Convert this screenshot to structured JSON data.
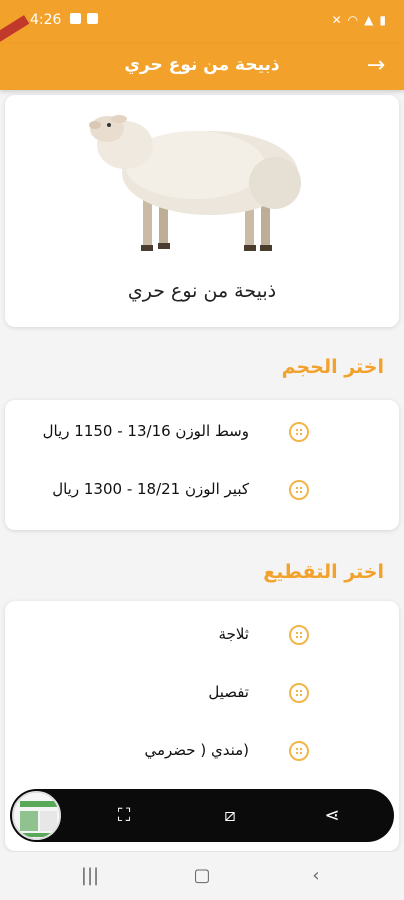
{
  "status": {
    "time": "4:26"
  },
  "header": {
    "title": "ذبيحة من نوع حري",
    "back_icon": "arrow-right-icon"
  },
  "product": {
    "name": "ذبيحة من نوع حري",
    "image": "sheep-image"
  },
  "sizes": {
    "title": "اختر الحجم",
    "options": [
      {
        "label": "وسط الوزن 13/16 -  1150   ريال"
      },
      {
        "label": "كبير الوزن 18/21 -  1300   ريال"
      }
    ]
  },
  "cutting": {
    "title": "اختر التقطيع",
    "options": [
      {
        "label": "ثلاجة"
      },
      {
        "label": "تفصيل"
      },
      {
        "label": "(مندي ( حضرمي"
      }
    ]
  },
  "colors": {
    "accent": "#f2a12a",
    "radio": "#f2b54a"
  }
}
